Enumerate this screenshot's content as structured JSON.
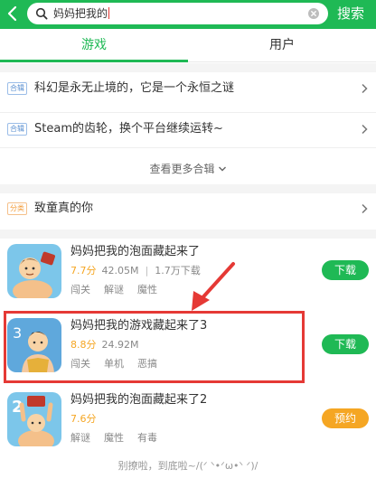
{
  "search": {
    "query": "妈妈把我的",
    "button_label": "搜索"
  },
  "tabs": [
    {
      "label": "游戏",
      "active": true
    },
    {
      "label": "用户",
      "active": false
    }
  ],
  "collections": [
    {
      "tag": "合辑",
      "title": "科幻是永无止境的，它是一个永恒之谜"
    },
    {
      "tag": "合辑",
      "title": "Steam的齿轮，换个平台继续运转~"
    }
  ],
  "more_collections_label": "查看更多合辑",
  "category": {
    "tag": "分类",
    "title": "致童真的你"
  },
  "games": [
    {
      "title": "妈妈把我的泡面藏起来了",
      "rating": "7.7分",
      "size": "42.05M",
      "downloads": "1.7万下载",
      "tags": [
        "闯关",
        "解谜",
        "魔性"
      ],
      "action": "下载",
      "action_color": "#1fb955"
    },
    {
      "title": "妈妈把我的游戏藏起来了3",
      "rating": "8.8分",
      "size": "24.92M",
      "downloads": "",
      "tags": [
        "闯关",
        "单机",
        "恶搞"
      ],
      "action": "下载",
      "action_color": "#1fb955"
    },
    {
      "title": "妈妈把我的泡面藏起来了2",
      "rating": "7.6分",
      "size": "",
      "downloads": "",
      "tags": [
        "解谜",
        "魔性",
        "有毒"
      ],
      "action": "预约",
      "action_color": "#f5a623"
    }
  ],
  "footer_text": "别撩啦，到底啦~/(ᐟ ᐠ•ᐟω•ᐠ ᐟ)/",
  "colors": {
    "brand": "#1fb955",
    "reserve": "#f5a623",
    "highlight": "#e53935"
  }
}
